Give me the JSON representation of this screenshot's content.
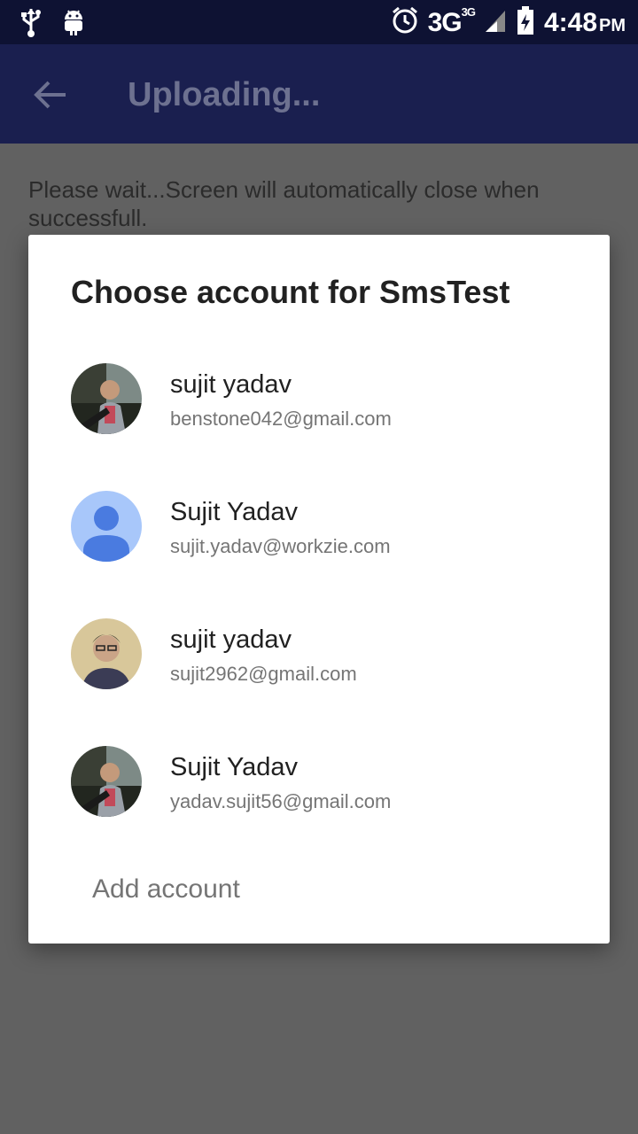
{
  "status_bar": {
    "network": "3G",
    "network_sup": "3G",
    "time": "4:48",
    "ampm": "PM",
    "icons": [
      "usb-icon",
      "android-icon",
      "alarm-icon",
      "signal-icon",
      "battery-icon"
    ]
  },
  "app_bar": {
    "title": "Uploading..."
  },
  "page": {
    "message": "Please wait...Screen will automatically close when successfull."
  },
  "dialog": {
    "title": "Choose account for SmsTest",
    "accounts": [
      {
        "name": "sujit yadav",
        "email": "benstone042@gmail.com"
      },
      {
        "name": "Sujit Yadav",
        "email": "sujit.yadav@workzie.com"
      },
      {
        "name": "sujit yadav",
        "email": "sujit2962@gmail.com"
      },
      {
        "name": "Sujit Yadav",
        "email": "yadav.sujit56@gmail.com"
      }
    ],
    "add_account": "Add account"
  },
  "colors": {
    "status_bar": "#0e1233",
    "app_bar": "#1a1f4f",
    "scrim": "#616161",
    "default_avatar_bg": "#a8c7fa",
    "default_avatar_fg": "#4a7be0"
  }
}
